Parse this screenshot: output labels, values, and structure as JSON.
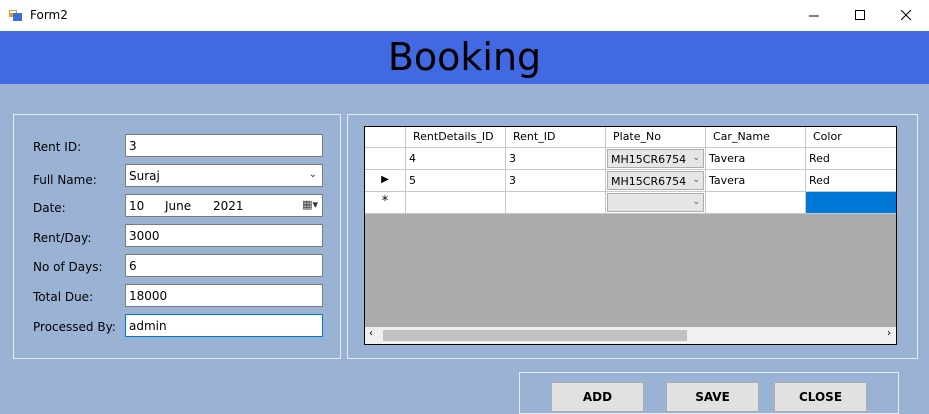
{
  "window": {
    "title": "Form2"
  },
  "header": {
    "title": "Booking"
  },
  "form": {
    "rent_id": {
      "label": "Rent ID:",
      "value": "3"
    },
    "full_name": {
      "label": "Full Name:",
      "value": "Suraj"
    },
    "date": {
      "label": "Date:",
      "day": "10",
      "month": "June",
      "year": "2021"
    },
    "rent_per_day": {
      "label": "Rent/Day:",
      "value": "3000"
    },
    "no_of_days": {
      "label": "No of Days:",
      "value": "6"
    },
    "total_due": {
      "label": "Total Due:",
      "value": "18000"
    },
    "processed_by": {
      "label": "Processed By:",
      "value": "admin"
    }
  },
  "grid": {
    "columns": [
      "RentDetails_ID",
      "Rent_ID",
      "Plate_No",
      "Car_Name",
      "Color"
    ],
    "rows": [
      [
        "4",
        "3",
        "MH15CR6754",
        "Tavera",
        "Red"
      ],
      [
        "5",
        "3",
        "MH15CR6754",
        "Tavera",
        "Red"
      ]
    ],
    "current_row_marker": "▶",
    "new_row_marker": "*"
  },
  "buttons": {
    "add": "ADD",
    "save": "SAVE",
    "close": "CLOSE"
  }
}
